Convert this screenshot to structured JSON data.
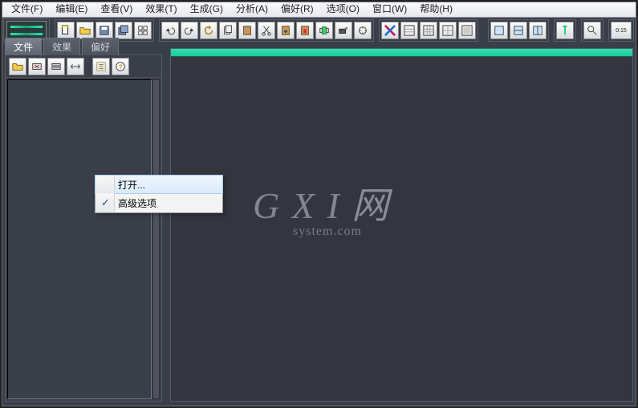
{
  "menu": {
    "file": "文件(F)",
    "edit": "编辑(E)",
    "view": "查看(V)",
    "effects": "效果(T)",
    "generate": "生成(G)",
    "analyze": "分析(A)",
    "favorites": "偏好(R)",
    "options": "选项(O)",
    "window": "窗口(W)",
    "help": "帮助(H)"
  },
  "side_tabs": {
    "files": "文件",
    "effects": "效果",
    "favorites": "偏好"
  },
  "context_menu": {
    "open": "打开...",
    "advanced": "高级选项"
  },
  "watermark": {
    "big": "G X I",
    "net": "网",
    "small": "system.com"
  },
  "colors": {
    "accent": "#24d8a6",
    "panel": "#3a3e49"
  }
}
